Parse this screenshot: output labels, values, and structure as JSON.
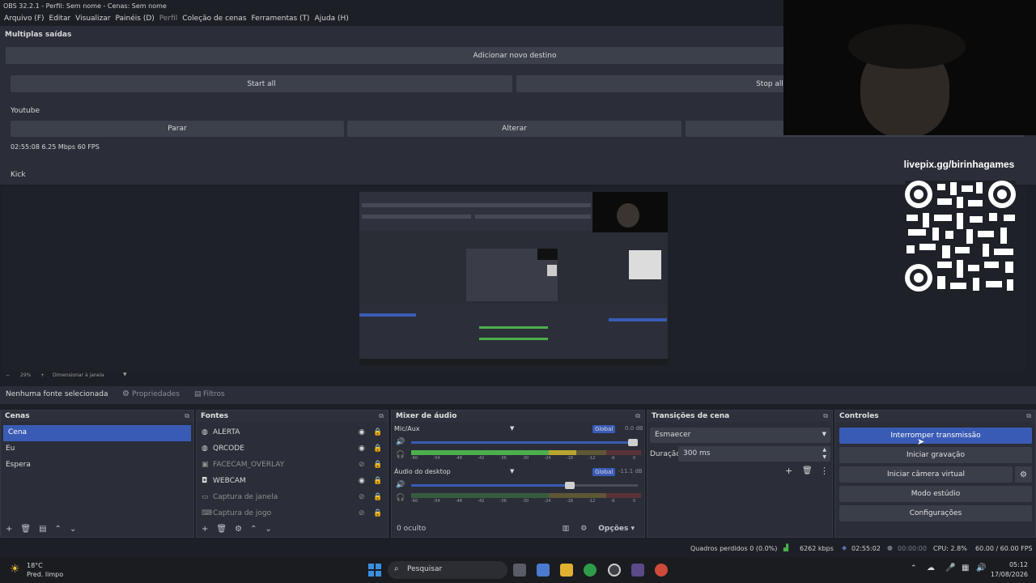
{
  "window": {
    "title": "OBS 32.2.1 - Perfil: Sem nome - Cenas: Sem nome"
  },
  "menu": [
    {
      "label": "Arquivo (F)",
      "disabled": false
    },
    {
      "label": "Editar",
      "disabled": false
    },
    {
      "label": "Visualizar",
      "disabled": false
    },
    {
      "label": "Painéis (D)",
      "disabled": false
    },
    {
      "label": "Perfil",
      "disabled": true
    },
    {
      "label": "Coleção de cenas",
      "disabled": false
    },
    {
      "label": "Ferramentas (T)",
      "disabled": false
    },
    {
      "label": "Ajuda (H)",
      "disabled": false
    }
  ],
  "multi_output": {
    "title": "Multiplas saídas",
    "add_destination": "Adicionar novo destino",
    "start_all": "Start all",
    "stop_all": "Stop all",
    "youtube": {
      "name": "Youtube",
      "stop": "Parar",
      "edit": "Alterar",
      "stats": "02:55:08  6.25 Mbps  60 FPS"
    },
    "kick": {
      "name": "Kick"
    }
  },
  "overlay": {
    "qr_label": "livepix.gg/birinhagames"
  },
  "preview": {
    "zoom_minus": "−",
    "zoom_value": "29%",
    "zoom_plus": "+",
    "scale_mode": "Dimensionar à janela"
  },
  "source_toolbar": {
    "no_source": "Nenhuma fonte selecionada",
    "properties": "Propriedades",
    "filters": "Filtros"
  },
  "scenes": {
    "title": "Cenas",
    "items": [
      {
        "label": "Cena",
        "selected": true
      },
      {
        "label": "Eu",
        "selected": false
      },
      {
        "label": "Espera",
        "selected": false
      }
    ]
  },
  "sources": {
    "title": "Fontes",
    "items": [
      {
        "label": "ALERTA",
        "icon": "globe-icon",
        "visible": true
      },
      {
        "label": "QRCODE",
        "icon": "globe-icon",
        "visible": true
      },
      {
        "label": "FACECAM_OVERLAY",
        "icon": "image-icon",
        "visible": false
      },
      {
        "label": "WEBCAM",
        "icon": "camera-icon",
        "visible": true
      },
      {
        "label": "Captura de janela",
        "icon": "window-icon",
        "visible": false
      },
      {
        "label": "Captura de jogo",
        "icon": "gamepad-icon",
        "visible": false
      }
    ]
  },
  "mixer": {
    "title": "Mixer de áudio",
    "channels": [
      {
        "name": "Mic/Aux",
        "tag": "Global",
        "db": "0.0 dB",
        "volume": 0.98,
        "level": 0.72
      },
      {
        "name": "Áudio do desktop",
        "tag": "Global",
        "db": "-11.1 dB",
        "volume": 0.7,
        "level": 0.0
      }
    ],
    "scale": [
      "-60",
      "-54",
      "-48",
      "-42",
      "-36",
      "-30",
      "-24",
      "-18",
      "-12",
      "-6",
      "0"
    ],
    "hidden": "0 oculto",
    "options": "Opções"
  },
  "transitions": {
    "title": "Transições de cena",
    "selected": "Esmaecer",
    "duration_label": "Duração",
    "duration_value": "300 ms"
  },
  "controls": {
    "title": "Controles",
    "stop_stream": "Interromper transmissão",
    "start_recording": "Iniciar gravação",
    "start_virtualcam": "Iniciar câmera virtual",
    "studio_mode": "Modo estúdio",
    "settings": "Configurações"
  },
  "status": {
    "dropped": "Quadros perdidos 0 (0.0%)",
    "bitrate": "6262 kbps",
    "stream_time": "02:55:02",
    "rec_time": "00:00:00",
    "cpu": "CPU: 2.8%",
    "fps": "60.00 / 60.00 FPS"
  },
  "taskbar": {
    "weather_temp": "18°C",
    "weather_desc": "Pred. limpo",
    "search": "Pesquisar",
    "time": "05:12",
    "date": "17/08/2026"
  },
  "colors": {
    "accent": "#3a5bb5",
    "meter_green": "#4cae4c",
    "meter_yellow": "#b9a433",
    "meter_red": "#b0383a"
  }
}
